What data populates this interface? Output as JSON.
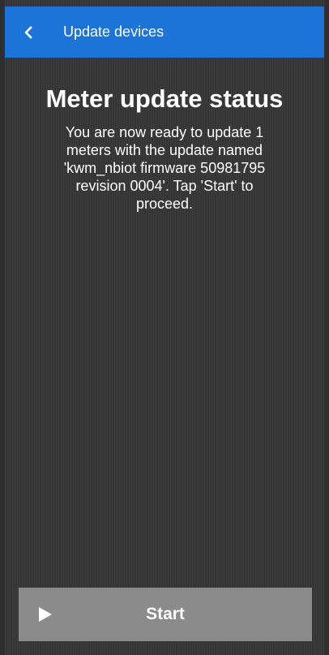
{
  "header": {
    "back_icon": "chevron-left-icon",
    "title": "Update devices"
  },
  "main": {
    "title": "Meter update status",
    "message": "You are now ready to update 1 meters with the update named 'kwm_nbiot firmware 50981795 revision 0004'. Tap 'Start' to proceed."
  },
  "actions": {
    "start_icon": "play-icon",
    "start_label": "Start"
  },
  "colors": {
    "header_bg": "#1c74d8",
    "background": "#3a3a3a",
    "button_bg": "#8b8b8b",
    "text": "#ffffff"
  }
}
